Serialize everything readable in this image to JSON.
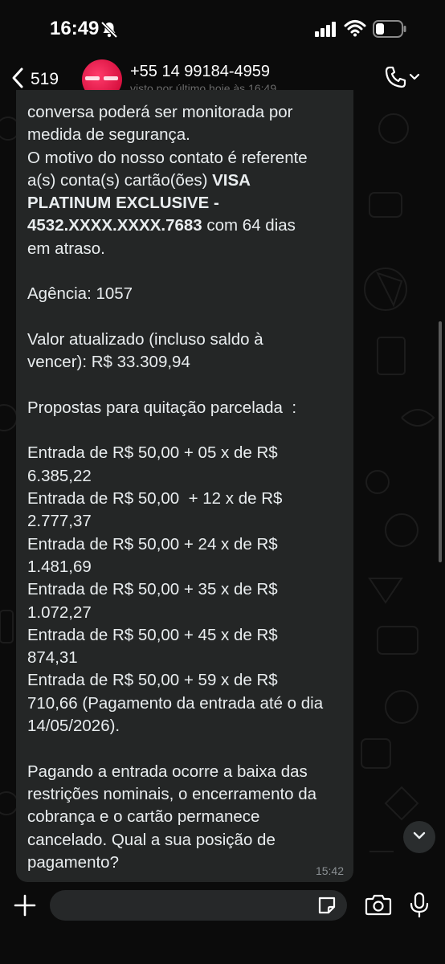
{
  "status_bar": {
    "time": "16:49"
  },
  "header": {
    "back_count": "519",
    "contact_name": "+55 14 99184-4959",
    "contact_status": "visto por último hoje às 16:49"
  },
  "message": {
    "segments": [
      {
        "text": "conversa poderá ser monitorada por\nmedida de segurança.\nO motivo do nosso contato é referente\na(s) conta(s) cartão(ões) ",
        "bold": false
      },
      {
        "text": "VISA\nPLATINUM EXCLUSIVE -\n4532.XXXX.XXXX.7683",
        "bold": true
      },
      {
        "text": " com 64 dias\nem atraso.\n\nAgência: 1057\n\nValor atualizado (incluso saldo à\nvencer): R$ 33.309,94\n\nPropostas para quitação parcelada  :\n\nEntrada de R$ 50,00 + 05 x de R$\n6.385,22\nEntrada de R$ 50,00  + 12 x de R$\n2.777,37\nEntrada de R$ 50,00 + 24 x de R$\n1.481,69\nEntrada de R$ 50,00 + 35 x de R$\n1.072,27\nEntrada de R$ 50,00 + 45 x de R$\n874,31\nEntrada de R$ 50,00 + 59 x de R$\n710,66 (Pagamento da entrada até o dia\n14/05/2026).\n\nPagando a entrada ocorre a baixa das\nrestrições nominais, o encerramento da\ncobrança e o cartão permanece\ncancelado. Qual a sua posição de\npagamento?",
        "bold": false
      }
    ],
    "time": "15:42"
  },
  "input": {
    "placeholder": ""
  },
  "icons": {
    "back": "chevron-left-icon",
    "bell": "bell-slash-icon",
    "signal": "cellular-signal-icon",
    "wifi": "wifi-icon",
    "battery": "battery-icon",
    "call": "phone-icon",
    "scroll_down": "chevron-down-icon",
    "plus": "plus-icon",
    "sticker": "sticker-icon",
    "camera": "camera-icon",
    "mic": "microphone-icon"
  },
  "colors": {
    "background": "#0b0b0b",
    "bubble": "#242626",
    "text": "#e9edef",
    "muted": "#8a8f92",
    "avatar": "#e0103f"
  }
}
